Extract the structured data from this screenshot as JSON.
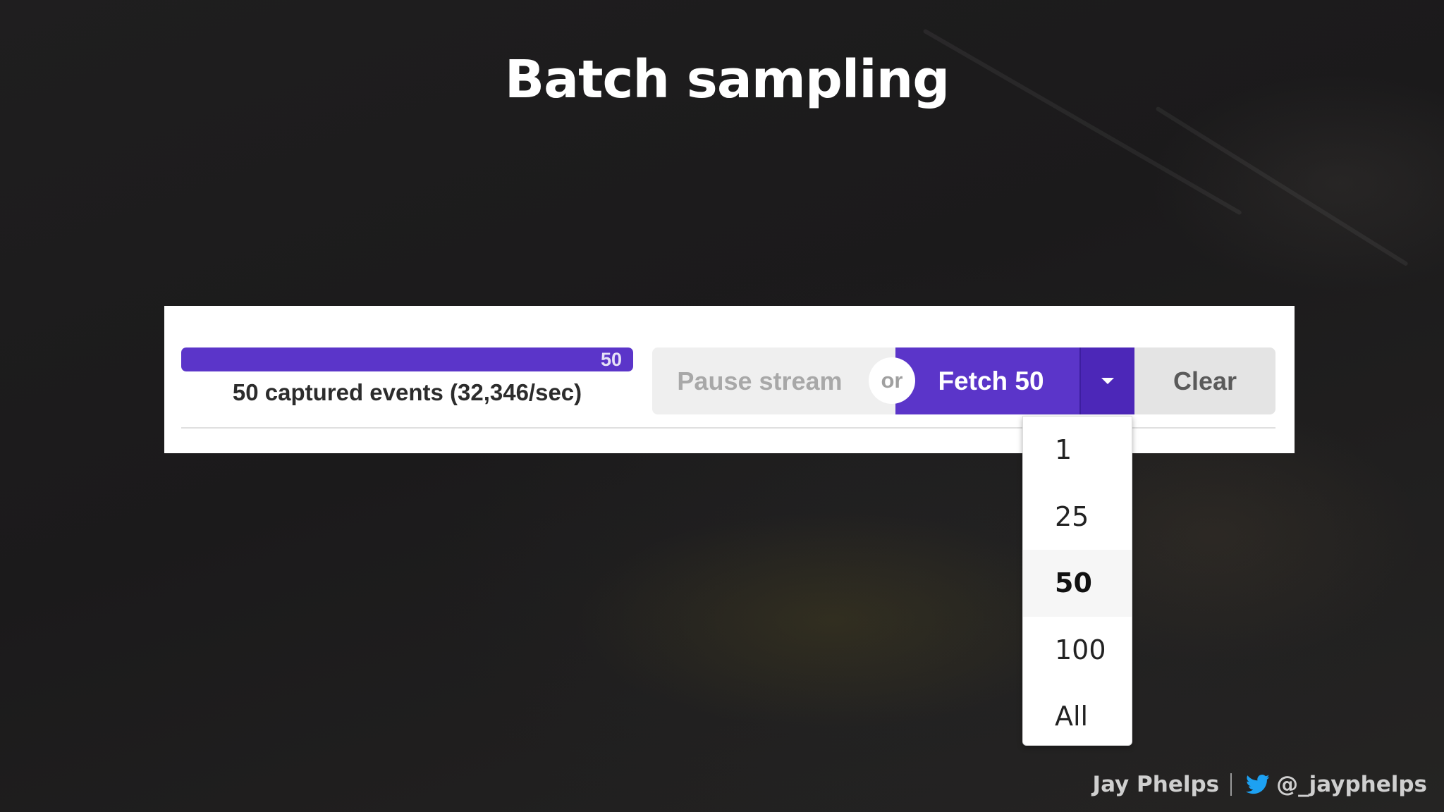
{
  "slide": {
    "title": "Batch sampling"
  },
  "event_bar": {
    "progress_label": "50",
    "progress_fraction": 1.0,
    "captured_text": "50 captured events (32,346/sec)"
  },
  "controls": {
    "pause_label": "Pause stream",
    "or_label": "or",
    "fetch_label": "Fetch 50",
    "clear_label": "Clear"
  },
  "dropdown": {
    "options": [
      "1",
      "25",
      "50",
      "100",
      "All"
    ],
    "selected": "50"
  },
  "footer": {
    "author": "Jay Phelps",
    "handle": "@_jayphelps"
  },
  "colors": {
    "accent": "#5b35c9",
    "accent_dark": "#4c27b8",
    "twitter": "#1da1f2"
  },
  "icons": {
    "caret": "chevron-down-icon",
    "social": "twitter-icon"
  }
}
